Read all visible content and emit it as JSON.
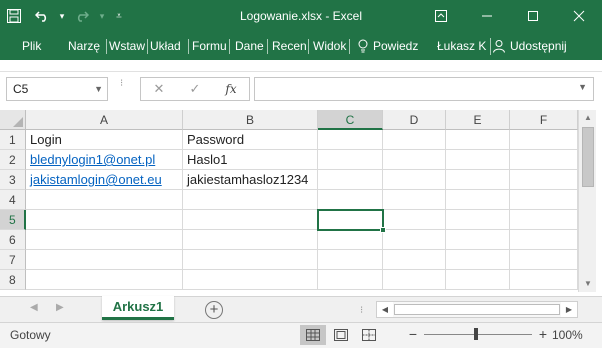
{
  "titlebar": {
    "title": "Logowanie.xlsx - Excel",
    "background": "#217346"
  },
  "ribbon": {
    "tabs": [
      "Plik",
      "Narzę",
      "Wstaw",
      "Układ",
      "Formu",
      "Dane",
      "Recen",
      "Widok"
    ],
    "tell_me": "Powiedz",
    "user": "Łukasz K",
    "share": "Udostępnij"
  },
  "formula_bar": {
    "name_box": "C5",
    "formula": "",
    "fx_label": "fx"
  },
  "grid": {
    "columns": [
      "A",
      "B",
      "C",
      "D",
      "E",
      "F"
    ],
    "rows": [
      "1",
      "2",
      "3",
      "4",
      "5",
      "6",
      "7",
      "8"
    ],
    "selected_column": "C",
    "selected_row": "5",
    "cells": {
      "A1": "Login",
      "B1": "Password",
      "A2": "blednylogin1@onet.pl",
      "B2": "Haslo1",
      "A3": "jakistamlogin@onet.eu",
      "B3": "jakiestamhasloz1234"
    },
    "link_color": "#0563c1",
    "accent": "#217346"
  },
  "sheets": {
    "tabs": [
      "Arkusz1"
    ],
    "active": "Arkusz1"
  },
  "statusbar": {
    "status": "Gotowy",
    "zoom": "100%"
  }
}
